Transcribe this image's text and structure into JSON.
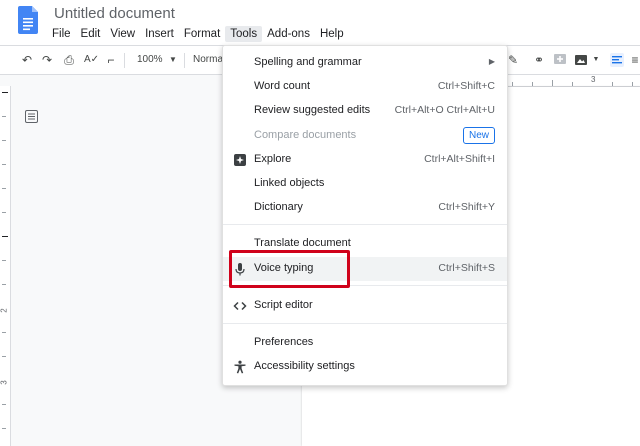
{
  "app": {
    "doc_title": "Untitled document"
  },
  "menubar": [
    "File",
    "Edit",
    "View",
    "Insert",
    "Format",
    "Tools",
    "Add-ons",
    "Help"
  ],
  "toolbar": {
    "zoom": "100%",
    "style": "Normal"
  },
  "ruler": {
    "numbers": [
      "1",
      "2",
      "3"
    ]
  },
  "tools_menu": {
    "items": [
      {
        "label": "Spelling and grammar",
        "shortcut": "",
        "submenu": true
      },
      {
        "label": "Word count",
        "shortcut": "Ctrl+Shift+C"
      },
      {
        "label": "Review suggested edits",
        "shortcut": "Ctrl+Alt+O Ctrl+Alt+U"
      },
      {
        "label": "Compare documents",
        "shortcut": "",
        "badge": "New",
        "disabled": true
      },
      {
        "label": "Explore",
        "shortcut": "Ctrl+Alt+Shift+I",
        "icon": "explore-icon"
      },
      {
        "label": "Linked objects",
        "shortcut": ""
      },
      {
        "label": "Dictionary",
        "shortcut": "Ctrl+Shift+Y"
      },
      {
        "label": "Translate document",
        "shortcut": ""
      },
      {
        "label": "Voice typing",
        "shortcut": "Ctrl+Shift+S",
        "icon": "microphone-icon",
        "highlighted": true
      },
      {
        "label": "Script editor",
        "shortcut": "",
        "icon": "code-icon"
      },
      {
        "label": "Preferences",
        "shortcut": ""
      },
      {
        "label": "Accessibility settings",
        "shortcut": "",
        "icon": "accessibility-icon"
      }
    ]
  },
  "colors": {
    "accent": "#1a73e8",
    "highlight_box": "#d0021b",
    "docs_blue": "#4285f4"
  }
}
